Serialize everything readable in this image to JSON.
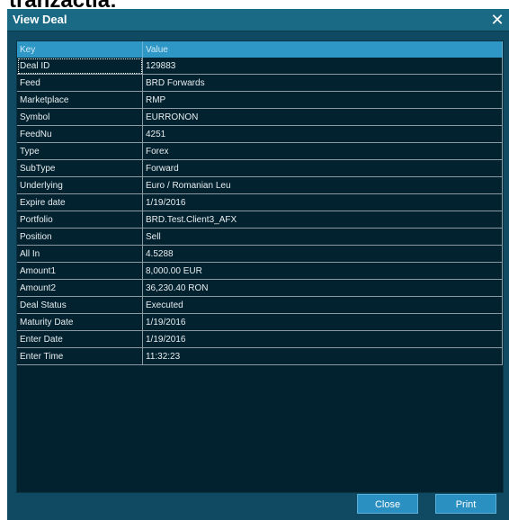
{
  "background_text": "tranzactia:",
  "dialog": {
    "title": "View Deal",
    "close_glyph": "✕"
  },
  "table": {
    "headers": [
      "Key",
      "Value"
    ],
    "rows": [
      {
        "key": "Deal ID",
        "value": "129883"
      },
      {
        "key": "Feed",
        "value": "BRD Forwards"
      },
      {
        "key": "Marketplace",
        "value": "RMP"
      },
      {
        "key": "Symbol",
        "value": "EURRONON"
      },
      {
        "key": "FeedNu",
        "value": "4251"
      },
      {
        "key": "Type",
        "value": "Forex"
      },
      {
        "key": "SubType",
        "value": "Forward"
      },
      {
        "key": "Underlying",
        "value": "Euro / Romanian Leu"
      },
      {
        "key": "Expire date",
        "value": "1/19/2016"
      },
      {
        "key": "Portfolio",
        "value": "BRD.Test.Client3_AFX"
      },
      {
        "key": "Position",
        "value": "Sell"
      },
      {
        "key": "All In",
        "value": "4.5288"
      },
      {
        "key": "Amount1",
        "value": "8,000.00 EUR"
      },
      {
        "key": "Amount2",
        "value": "36,230.40 RON"
      },
      {
        "key": "Deal Status",
        "value": "Executed"
      },
      {
        "key": "Maturity Date",
        "value": "1/19/2016"
      },
      {
        "key": "Enter Date",
        "value": "1/19/2016"
      },
      {
        "key": "Enter Time",
        "value": "11:32:23"
      }
    ]
  },
  "buttons": {
    "close_label": "Close",
    "print_label": "Print"
  },
  "colors": {
    "dialog_bg": "#0f4a62",
    "titlebar": "#1a6a86",
    "header_row": "#2f97c6",
    "table_bg": "#03222f",
    "button": "#2a8fc1"
  }
}
